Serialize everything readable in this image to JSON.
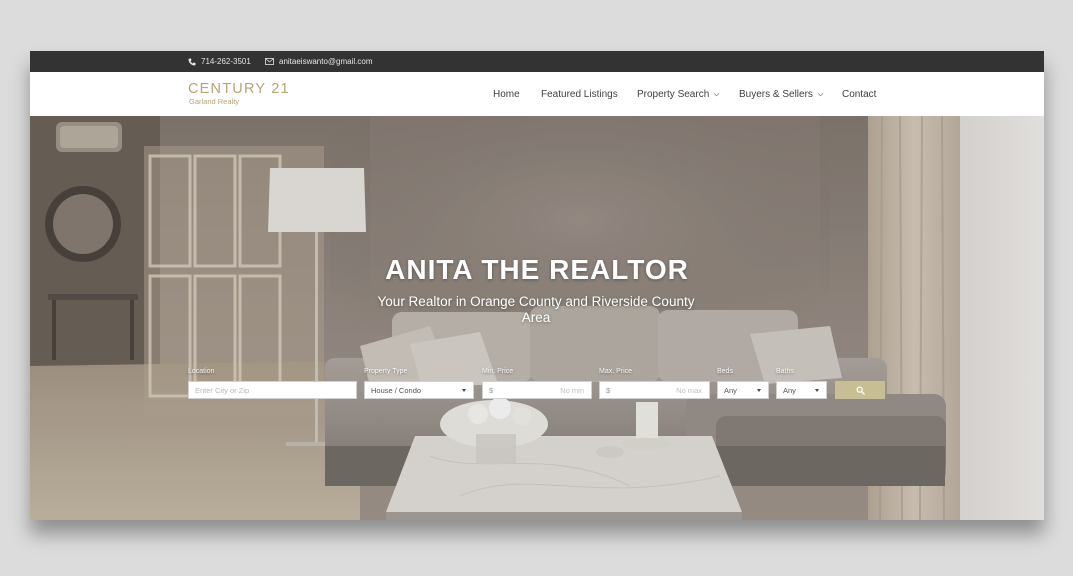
{
  "topbar": {
    "phone": "714-262-3501",
    "phone_icon": "phone-icon",
    "email": "anitaeiswanto@gmail.com",
    "email_icon": "envelope-icon"
  },
  "logo": {
    "brand": "CENTURY 21",
    "sub": "Garland Realty"
  },
  "nav": {
    "items": [
      {
        "label": "Home"
      },
      {
        "label": "Featured Listings"
      },
      {
        "label": "Property Search",
        "has_dropdown": true
      },
      {
        "label": "Buyers & Sellers",
        "has_dropdown": true
      },
      {
        "label": "Contact"
      }
    ]
  },
  "hero": {
    "title": "ANITA THE REALTOR",
    "subtitle": "Your Realtor in Orange County and Riverside County Area"
  },
  "search": {
    "location_label": "Location",
    "location_placeholder": "Enter City or Zip",
    "property_type_label": "Property Type",
    "property_type_value": "House / Condo",
    "min_price_label": "Min. Price",
    "min_price_prefix": "$",
    "min_price_placeholder": "No min",
    "max_price_label": "Max. Price",
    "max_price_prefix": "$",
    "max_price_placeholder": "No max",
    "beds_label": "Beds",
    "beds_value": "Any",
    "baths_label": "Baths",
    "baths_value": "Any",
    "button_icon": "search-icon"
  },
  "colors": {
    "topbar_bg": "#333333",
    "brand_gold": "#b5a675",
    "search_button": "#c7bf93",
    "nav_text": "#3f3f3f"
  }
}
